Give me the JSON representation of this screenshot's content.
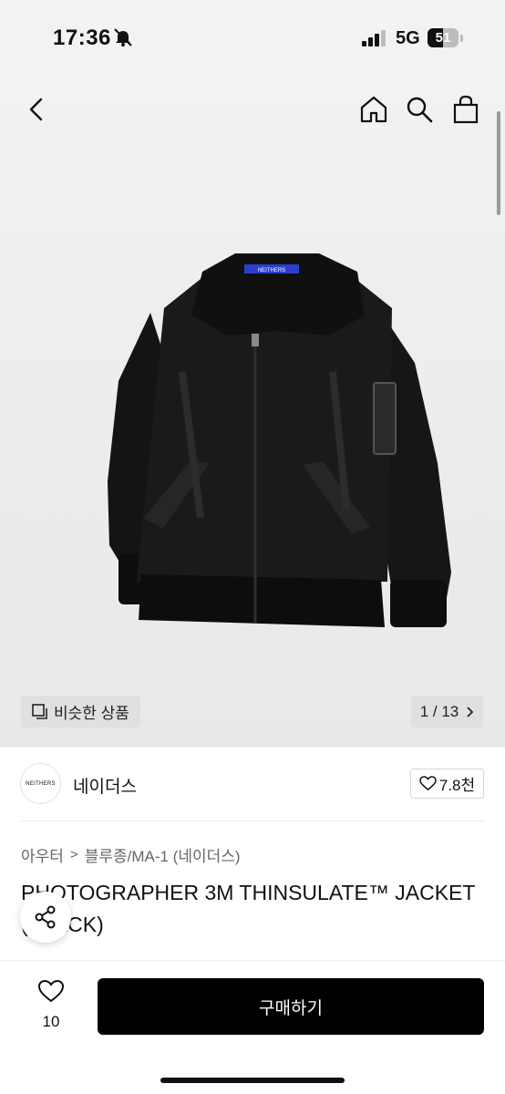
{
  "status_bar": {
    "time": "17:36",
    "network": "5G",
    "battery": "51"
  },
  "product_image": {
    "counter": "1 / 13",
    "similar_label": "비슷한 상품",
    "tag_text": "NEITHERS"
  },
  "brand": {
    "logo_text": "NEITHERS",
    "name": "네이더스",
    "likes": "7.8천"
  },
  "breadcrumb": {
    "level1": "아우터",
    "separator": ">",
    "level2": "블루종/MA-1 (네이더스)"
  },
  "product": {
    "title": "PHOTOGRAPHER 3M THINSULATE™ JACKET (BLACK)"
  },
  "bottom": {
    "wish_count": "10",
    "buy_label": "구매하기"
  },
  "icons": [
    "back-icon",
    "home-icon",
    "search-icon",
    "bag-icon",
    "similar-icon",
    "chevron-right-icon",
    "heart-icon",
    "share-icon",
    "bell-muted-icon",
    "signal-icon"
  ],
  "colors": {
    "buy_button": "#000000",
    "hero_background": "#eeeeee"
  }
}
